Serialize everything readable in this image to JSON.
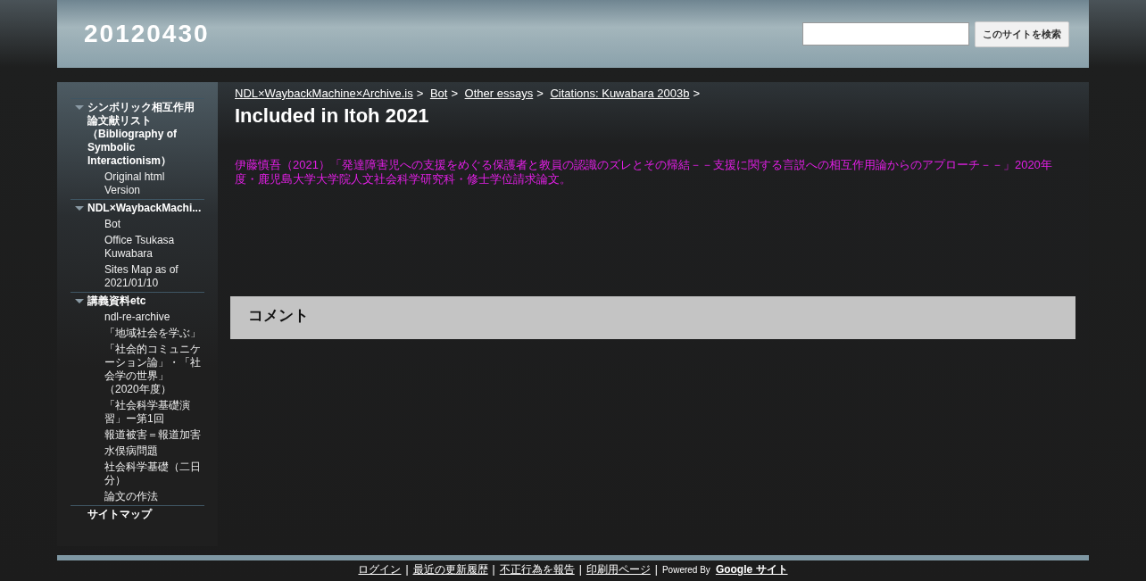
{
  "site_title": "20120430",
  "search": {
    "button": "このサイトを検索"
  },
  "sidebar": {
    "items": [
      {
        "label": "シンボリック相互作用論文献リスト（Bibliography of Symbolic Interactionism）",
        "expanded": true,
        "children": [
          {
            "label": "Original html Version"
          }
        ]
      },
      {
        "label": "NDL×WaybackMachi...",
        "expanded": true,
        "children": [
          {
            "label": "Bot"
          },
          {
            "label": "Office Tsukasa Kuwabara"
          },
          {
            "label": "Sites Map as of 2021/01/10"
          }
        ]
      },
      {
        "label": "講義資料etc",
        "expanded": true,
        "children": [
          {
            "label": "ndl-re-archive"
          },
          {
            "label": "「地域社会を学ぶ」"
          },
          {
            "label": "「社会的コミュニケーション論」・「社会学の世界」（2020年度）"
          },
          {
            "label": "「社会科学基礎演習」ー第1回"
          },
          {
            "label": "報道被害＝報道加害"
          },
          {
            "label": "水俣病問題"
          },
          {
            "label": "社会科学基礎（二日分）"
          },
          {
            "label": "論文の作法"
          }
        ]
      },
      {
        "label": "サイトマップ"
      }
    ]
  },
  "breadcrumb": [
    {
      "label": "NDL×WaybackMachine×Archive.is",
      "separator": ">"
    },
    {
      "label": "Bot",
      "separator": ">"
    },
    {
      "label": "Other essays",
      "separator": ">"
    },
    {
      "label": "Citations: Kuwabara 2003b",
      "separator": ">"
    }
  ],
  "page_title": "Included in Itoh 2021",
  "body_text": "伊藤慎吾（2021）「発達障害児への支援をめぐる保護者と教員の認識のズレとその帰結－－支援に関する言説への相互作用論からのアプローチ－－」2020年度・鹿児島大学大学院人文社会科学研究科・修士学位請求論文。",
  "comments": {
    "title": "コメント"
  },
  "footer": {
    "links": [
      {
        "label": "ログイン",
        "separator": "|"
      },
      {
        "label": "最近の更新履歴",
        "separator": "|"
      },
      {
        "label": "不正行為を報告",
        "separator": "|"
      },
      {
        "label": "印刷用ページ",
        "separator": "|"
      }
    ],
    "powered_by": "Powered By",
    "brand": "Google サイト"
  }
}
